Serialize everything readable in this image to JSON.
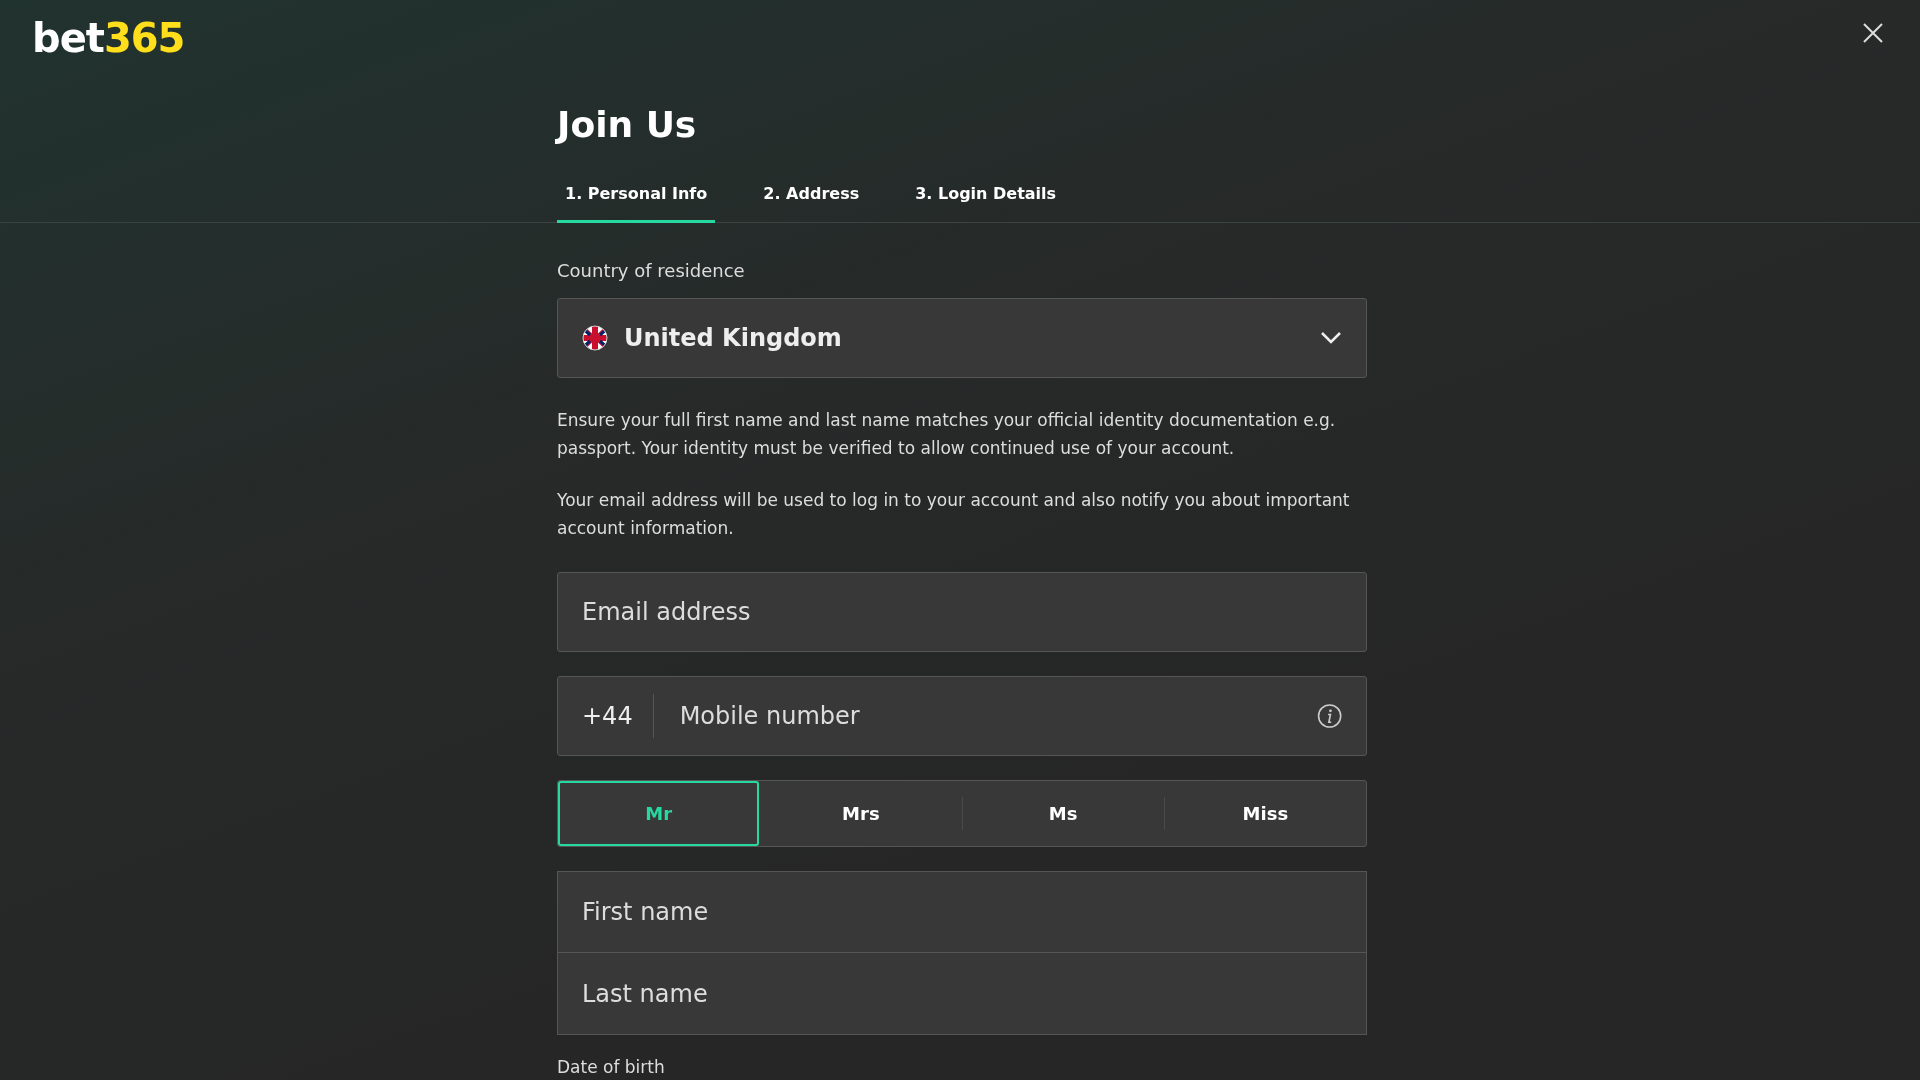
{
  "logo": {
    "text_a": "bet",
    "text_b": "365"
  },
  "title": "Join Us",
  "tabs": [
    {
      "label": "1. Personal Info",
      "selected": true
    },
    {
      "label": "2. Address",
      "selected": false
    },
    {
      "label": "3. Login Details",
      "selected": false
    }
  ],
  "country": {
    "label": "Country of residence",
    "value": "United Kingdom"
  },
  "notes": [
    "Ensure your full first name and last name matches your official identity documentation e.g. passport. Your identity must be verified to allow continued use of your account.",
    "Your email address will be used to log in to your account and also notify you about important account information."
  ],
  "email": {
    "placeholder": "Email address"
  },
  "mobile": {
    "prefix": "+44",
    "placeholder": "Mobile number"
  },
  "titles": [
    {
      "label": "Mr",
      "selected": true
    },
    {
      "label": "Mrs",
      "selected": false
    },
    {
      "label": "Ms",
      "selected": false
    },
    {
      "label": "Miss",
      "selected": false
    }
  ],
  "names": [
    {
      "placeholder": "First name"
    },
    {
      "placeholder": "Last name"
    }
  ],
  "dob_label": "Date of birth"
}
